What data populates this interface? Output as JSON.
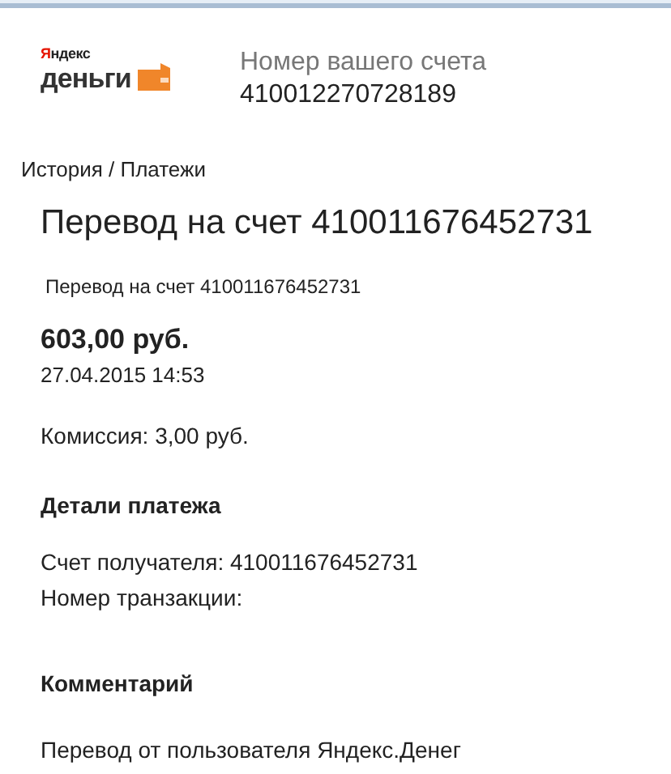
{
  "logo": {
    "brand_top": "Яндекс",
    "brand_bottom": "деньги"
  },
  "account": {
    "label": "Номер вашего счета",
    "number": "410012270728189"
  },
  "breadcrumb": "История / Платежи",
  "title": "Перевод на счет 410011676452731",
  "subtitle": "Перевод на счет 410011676452731",
  "amount": "603,00 руб.",
  "datetime": "27.04.2015 14:53",
  "commission": "Комиссия: 3,00 руб.",
  "details": {
    "heading": "Детали платежа",
    "lines": [
      "Счет получателя: 410011676452731",
      "Номер транзакции:"
    ]
  },
  "comment": {
    "heading": "Комментарий",
    "text": "Перевод от пользователя Яндекс.Денег"
  }
}
